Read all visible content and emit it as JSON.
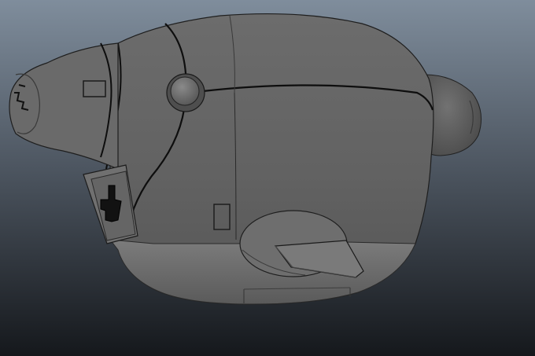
{
  "viewport": {
    "panel": "3d-perspective-viewport",
    "background_top_color": "#7f8d9c",
    "background_bottom_color": "#15181c",
    "model_base_color": "#636363",
    "model_highlight_color": "#7a7a7a",
    "model_shadow_color": "#3a3a3a",
    "edge_line_color": "#0e0e0e"
  },
  "model": {
    "parts": [
      "main-hull",
      "nose-cone",
      "rear-thruster",
      "side-bolt",
      "side-panel",
      "handle-knob",
      "lever-arm",
      "lower-skirt"
    ]
  }
}
